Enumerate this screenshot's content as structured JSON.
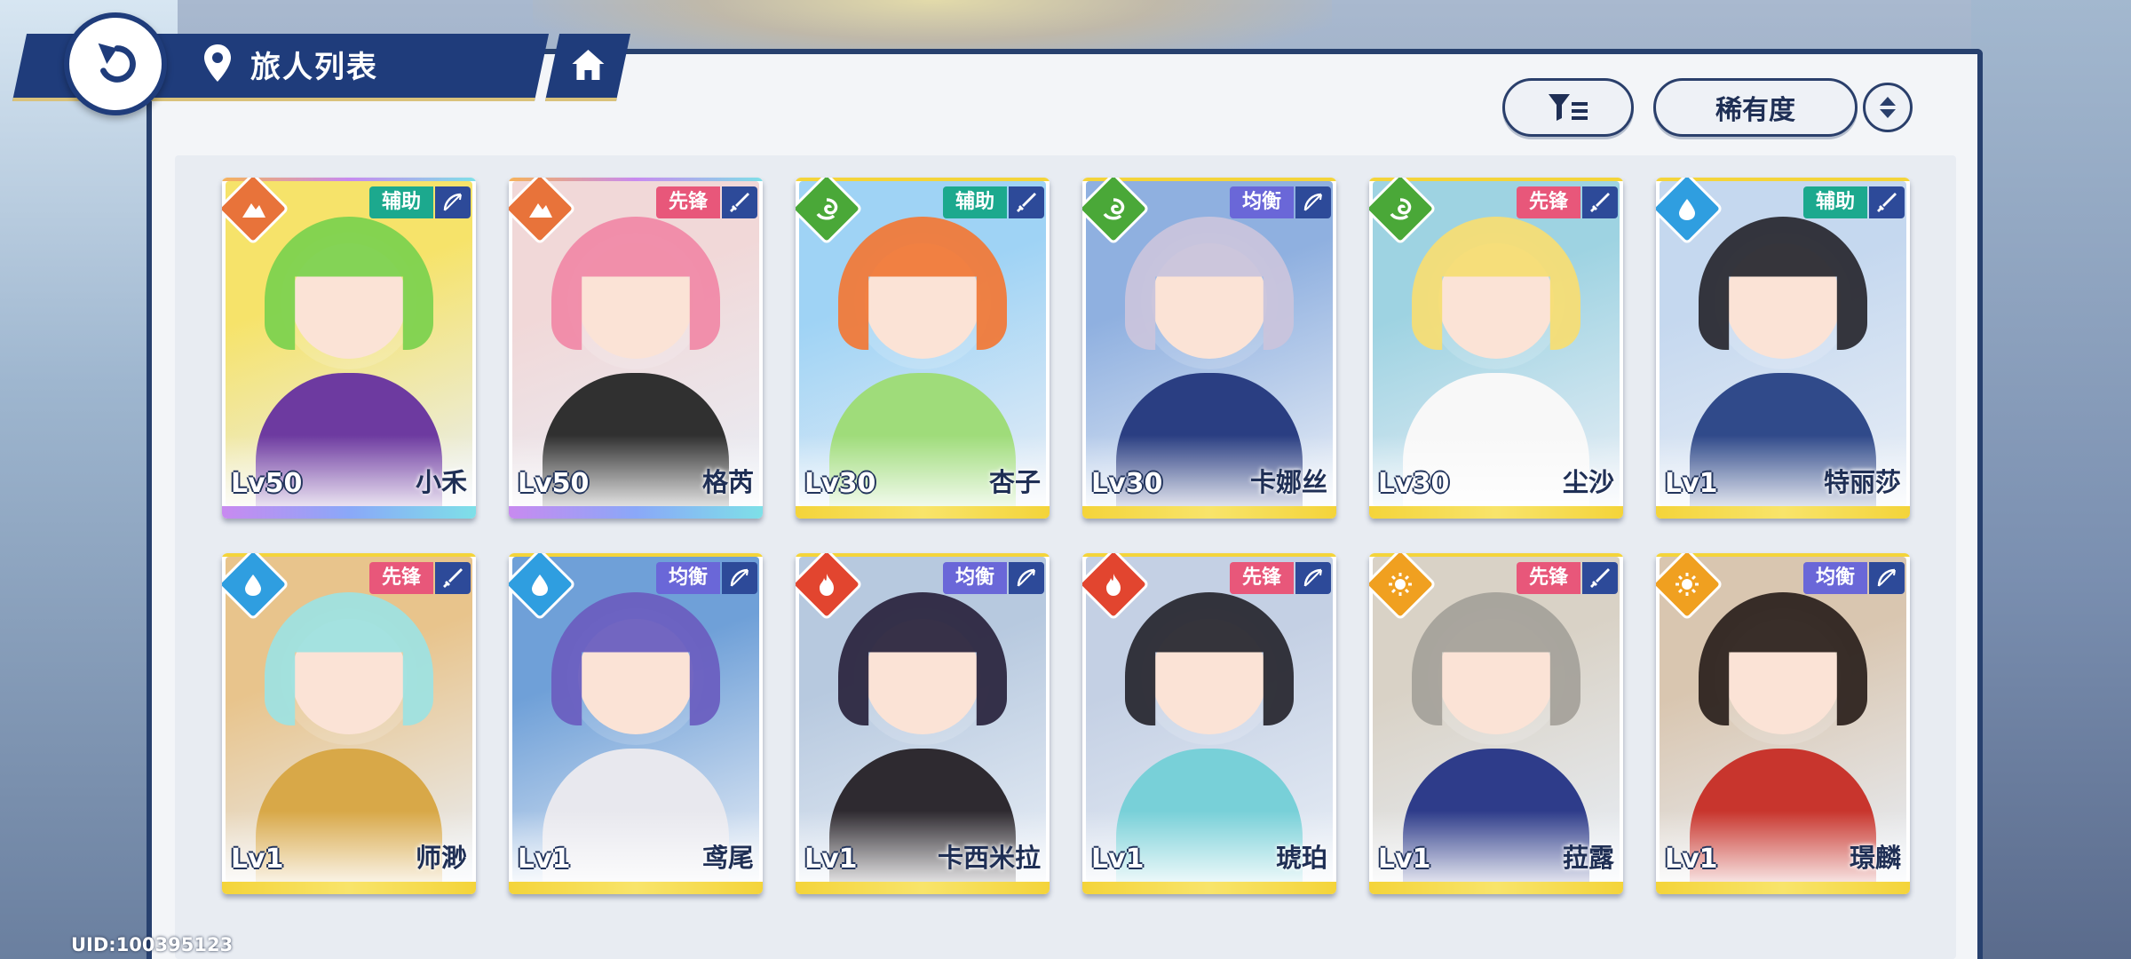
{
  "header": {
    "title": "旅人列表"
  },
  "toolbar": {
    "sort_label": "稀有度"
  },
  "footer": {
    "uid": "UID:100395123"
  },
  "colors": {
    "navy": "#1f3c7b",
    "role_support": "#1ca98e",
    "role_vanguard": "#e8577a",
    "role_balance": "#6a67d8",
    "rarity_top": "#f4d43a",
    "rarity_rainbow": "linear"
  },
  "characters": [
    {
      "name": "小禾",
      "level": "Lv50",
      "role": "辅助",
      "element": "mountain",
      "weapon": "bow-icon",
      "rarity": "rainbow"
    },
    {
      "name": "格芮",
      "level": "Lv50",
      "role": "先锋",
      "element": "mountain",
      "weapon": "sword-icon",
      "rarity": "rainbow"
    },
    {
      "name": "杏子",
      "level": "Lv30",
      "role": "辅助",
      "element": "wind",
      "weapon": "sword-icon",
      "rarity": "gold"
    },
    {
      "name": "卡娜丝",
      "level": "Lv30",
      "role": "均衡",
      "element": "wind",
      "weapon": "bow-icon",
      "rarity": "gold"
    },
    {
      "name": "尘沙",
      "level": "Lv30",
      "role": "先锋",
      "element": "wind",
      "weapon": "sword-icon",
      "rarity": "gold"
    },
    {
      "name": "特丽莎",
      "level": "Lv1",
      "role": "辅助",
      "element": "water",
      "weapon": "sword-icon",
      "rarity": "gold"
    },
    {
      "name": "师渺",
      "level": "Lv1",
      "role": "先锋",
      "element": "water",
      "weapon": "sword-icon",
      "rarity": "gold"
    },
    {
      "name": "鸢尾",
      "level": "Lv1",
      "role": "均衡",
      "element": "water",
      "weapon": "bow-icon",
      "rarity": "gold"
    },
    {
      "name": "卡西米拉",
      "level": "Lv1",
      "role": "均衡",
      "element": "fire",
      "weapon": "bow-icon",
      "rarity": "gold"
    },
    {
      "name": "琥珀",
      "level": "Lv1",
      "role": "先锋",
      "element": "fire",
      "weapon": "bow-icon",
      "rarity": "gold"
    },
    {
      "name": "菈露",
      "level": "Lv1",
      "role": "先锋",
      "element": "sun",
      "weapon": "sword-icon",
      "rarity": "gold"
    },
    {
      "name": "璟麟",
      "level": "Lv1",
      "role": "均衡",
      "element": "sun",
      "weapon": "bow-icon",
      "rarity": "gold"
    }
  ]
}
